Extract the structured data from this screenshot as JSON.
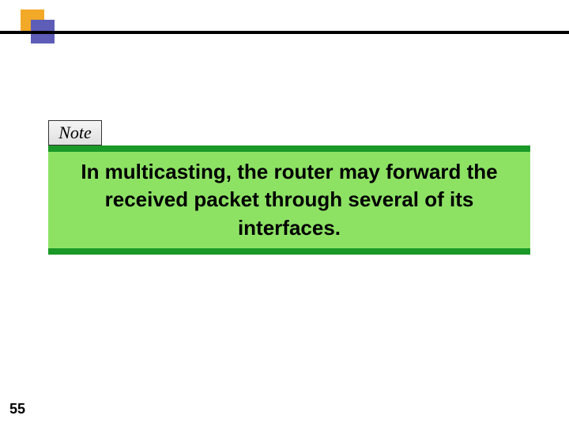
{
  "corner": {
    "orange_color": "#f2a928",
    "blue_color": "#5d5db8"
  },
  "note": {
    "label": "Note",
    "content": "In multicasting, the router may forward the received packet through several of its interfaces."
  },
  "page_number": "55",
  "colors": {
    "green_bar": "#1a9928",
    "green_box": "#8de264"
  }
}
